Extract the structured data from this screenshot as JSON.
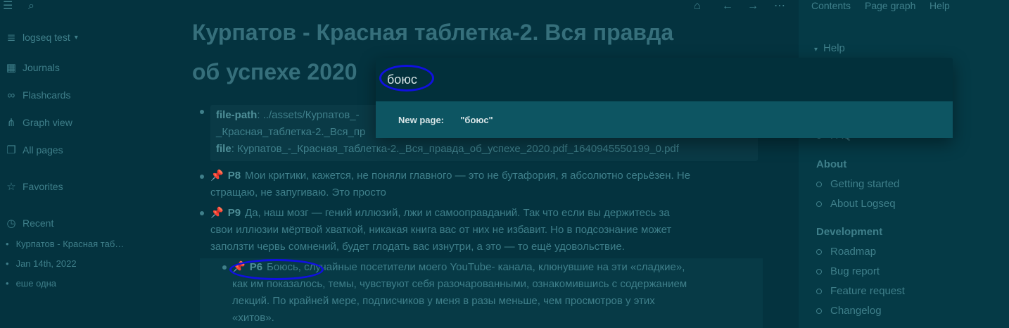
{
  "sidebar": {
    "graph_name": "logseq test",
    "nav": [
      "Journals",
      "Flashcards",
      "Graph view",
      "All pages"
    ],
    "favorites": "Favorites",
    "recent": "Recent",
    "recent_items": [
      "Курпатов - Красная таб…",
      "Jan 14th, 2022",
      "еше одна"
    ]
  },
  "main": {
    "title_line1": "Курпатов - Красная таблетка-2. Вся правда",
    "title_line2": "об успехе 2020",
    "code": {
      "k1": "file-path",
      "v1": ": ../assets/Курпатов_-",
      "l2": "_Красная_таблетка-2._Вся_пр",
      "k3": "file",
      "v3": ": Курпатов_-_Красная_таблетка-2._Вся_правда_об_успехе_2020.pdf_1640945550199_0.pdf"
    },
    "p8": {
      "tag": "P8",
      "l1": "Мои критики, кажется, не поняли главного — это не бутафория, я абсолютно серьёзен. Не",
      "l2": "стращаю, не запугиваю. Это просто"
    },
    "p9": {
      "tag": "P9",
      "l1": "Да, наш мозг — гений иллюзий, лжи и самооправданий. Так что если вы держитесь за",
      "l2": "свои иллюзии мёртвой хваткой, никакая книга вас от них не избавит. Но в подсознание может",
      "l3": "заползти червь сомнений, будет глодать вас изнутри, а это — то ещё удовольствие."
    },
    "p6": {
      "tag": "P6",
      "l1": "Боюсь, случайные посетители моего YouTube- канала, клюнувшие на эти «сладкие»,",
      "l2": "как им показалось, темы, чувствуют себя разочарованными, ознакомившись с содержанием",
      "l3": "лекций. По крайней мере, подписчиков у меня в разы меньше, чем просмотров у этих",
      "l4": "«хитов»."
    }
  },
  "right": {
    "tabs": [
      "Contents",
      "Page graph",
      "Help"
    ],
    "help": "Help",
    "faq": "FAQ",
    "about": "About",
    "about_links": [
      "Getting started",
      "About Logseq"
    ],
    "development": "Development",
    "dev_links": [
      "Roadmap",
      "Bug report",
      "Feature request",
      "Changelog"
    ]
  },
  "search": {
    "value": "боюс",
    "result_prefix": "New page:",
    "result_value": "\"боюс\""
  }
}
